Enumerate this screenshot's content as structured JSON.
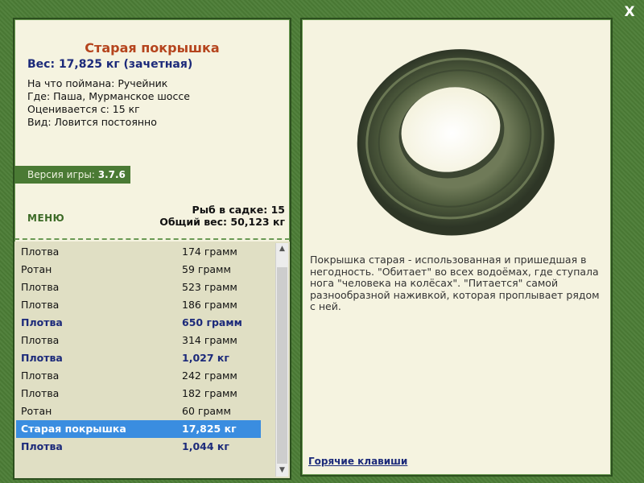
{
  "close_label": "X",
  "fish": {
    "title": "Старая покрышка",
    "weight": "Вес: 17,825 кг (зачетная)",
    "info": [
      "На что поймана: Ручейник",
      "Где: Паша, Мурманское шоссе",
      "Оценивается с: 15 кг",
      "Вид: Ловится постоянно"
    ]
  },
  "version": {
    "label": "Версия игры:",
    "value": "3.7.6"
  },
  "menu_label": "МЕНЮ",
  "stats": {
    "fish_in_cage": "Рыб в садке: 15",
    "total_weight": "Общий вес: 50,123 кг"
  },
  "catch_list": [
    {
      "name": "Плотва",
      "weight": "174 грамм"
    },
    {
      "name": "Ротан",
      "weight": "59 грамм"
    },
    {
      "name": "Плотва",
      "weight": "523 грамм"
    },
    {
      "name": "Плотва",
      "weight": "186 грамм"
    },
    {
      "name": "Плотва",
      "weight": "650 грамм"
    },
    {
      "name": "Плотва",
      "weight": "314 грамм"
    },
    {
      "name": "Плотва",
      "weight": "1,027 кг"
    },
    {
      "name": "Плотва",
      "weight": "242 грамм"
    },
    {
      "name": "Плотва",
      "weight": "182 грамм"
    },
    {
      "name": "Ротан",
      "weight": "60 грамм"
    },
    {
      "name": "Старая покрышка",
      "weight": "17,825 кг"
    },
    {
      "name": "Плотва",
      "weight": "1,044 кг"
    }
  ],
  "description": "Покрышка старая - использованная и пришедшая в негодность. \"Обитает\" во всех водоёмах, где ступала нога \"человека на колёсах\". \"Питается\" самой разнообразной наживкой, которая проплывает рядом с ней.",
  "hotkeys_label": "Горячие клавиши",
  "colors": {
    "frame": "#4c7d36",
    "panel": "#f5f3e0",
    "title": "#b5441d",
    "accent_blue": "#1c2a7a",
    "selection": "#3a8de0"
  },
  "icons": {
    "close": "close-icon",
    "scroll_up": "chevron-up-icon",
    "scroll_down": "chevron-down-icon",
    "picture": "tire-image"
  }
}
